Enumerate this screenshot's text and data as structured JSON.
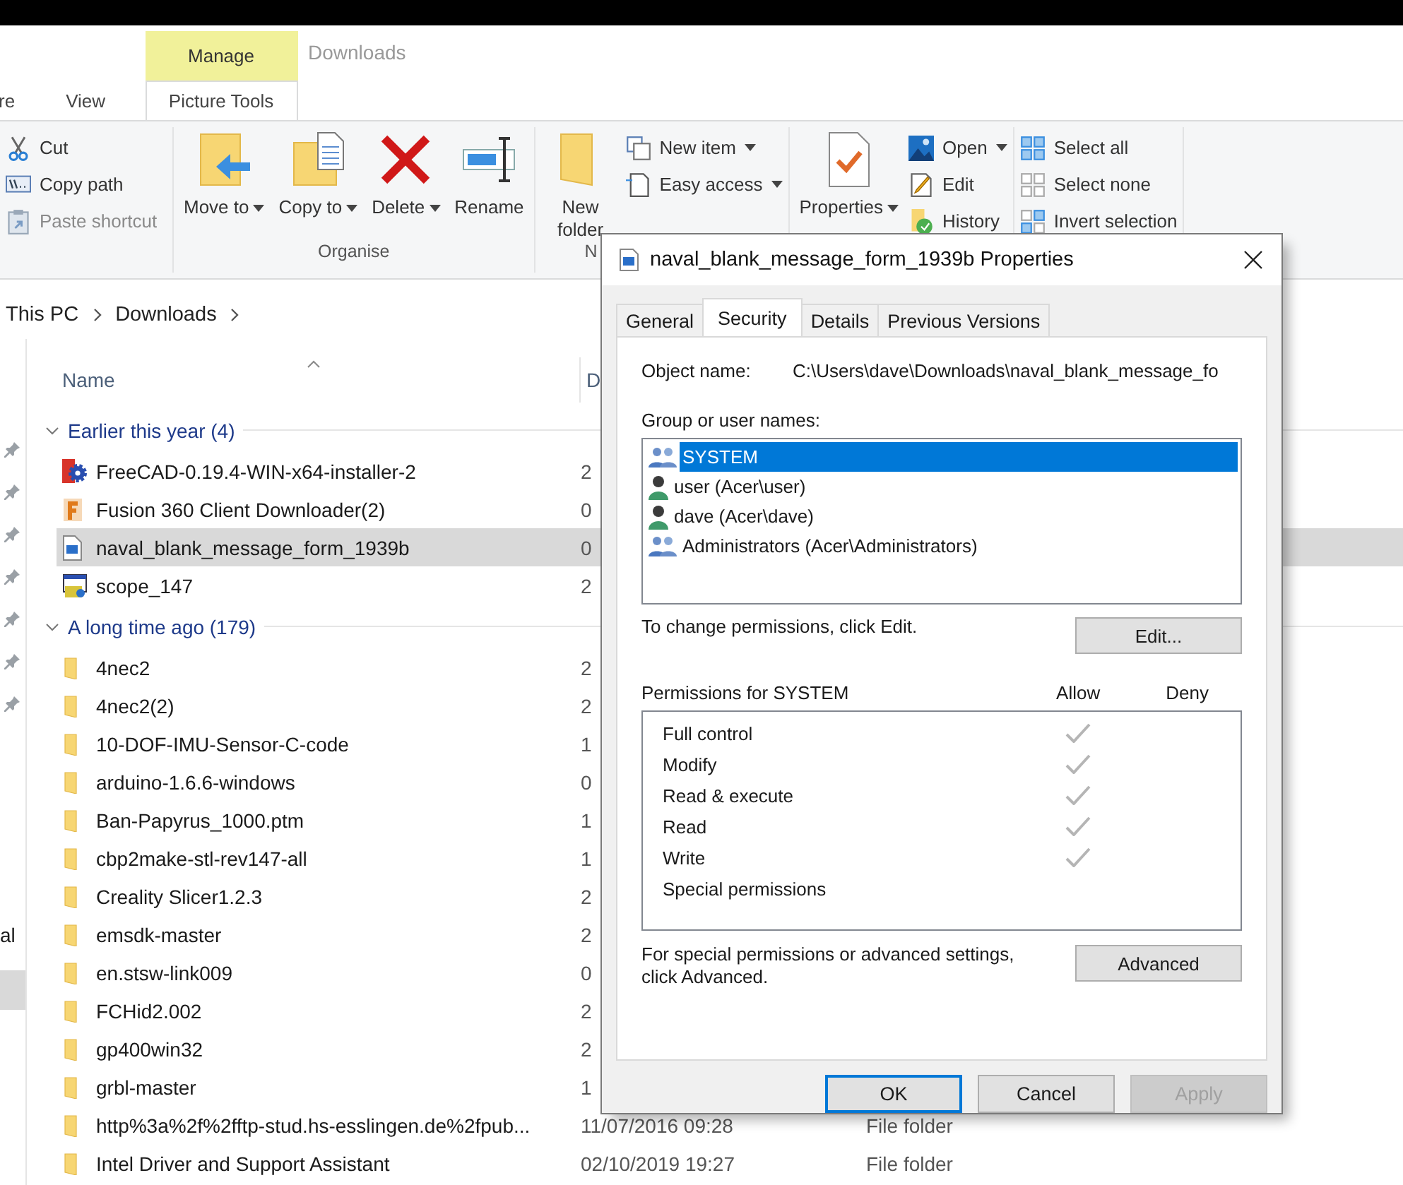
{
  "window": {
    "title": "Downloads"
  },
  "ribbon_tabs": [
    {
      "label": "re",
      "selected": false
    },
    {
      "label": "View",
      "selected": false
    },
    {
      "label": "Picture Tools",
      "selected": true,
      "context": "Manage"
    }
  ],
  "ribbon_groups": [
    {
      "items": [
        {
          "kind": "small",
          "label": "Cut",
          "dropdown": false,
          "disabled": false
        },
        {
          "kind": "small",
          "label": "Copy path",
          "dropdown": false,
          "disabled": false
        },
        {
          "kind": "small",
          "label": "Paste shortcut",
          "dropdown": false,
          "disabled": true
        }
      ]
    },
    {
      "label": "Organise",
      "items": [
        {
          "kind": "large",
          "label": "Move to",
          "dropdown": true,
          "disabled": false
        },
        {
          "kind": "large",
          "label": "Copy to",
          "dropdown": true,
          "disabled": false
        },
        {
          "kind": "large",
          "label": "Delete",
          "dropdown": true,
          "disabled": false
        },
        {
          "kind": "large",
          "label": "Rename",
          "dropdown": false,
          "disabled": false
        }
      ]
    },
    {
      "label": "N",
      "items": [
        {
          "kind": "large",
          "label": "New folder",
          "dropdown": false,
          "disabled": false
        },
        {
          "kind": "small",
          "label": "New item",
          "dropdown": true,
          "disabled": false
        },
        {
          "kind": "small",
          "label": "Easy access",
          "dropdown": true,
          "disabled": false
        }
      ]
    },
    {
      "items": [
        {
          "kind": "large",
          "label": "Properties",
          "dropdown": true,
          "disabled": false
        },
        {
          "kind": "small",
          "label": "Open",
          "dropdown": true,
          "disabled": false
        },
        {
          "kind": "small",
          "label": "Edit",
          "dropdown": false,
          "disabled": false
        },
        {
          "kind": "small",
          "label": "History",
          "dropdown": false,
          "disabled": false
        }
      ]
    },
    {
      "items": [
        {
          "kind": "small",
          "label": "Select all",
          "dropdown": false,
          "disabled": false
        },
        {
          "kind": "small",
          "label": "Select none",
          "dropdown": false,
          "disabled": false
        },
        {
          "kind": "small",
          "label": "Invert selection",
          "dropdown": false,
          "disabled": false
        }
      ]
    }
  ],
  "breadcrumbs": [
    "This PC",
    "Downloads"
  ],
  "quick_access": [
    {
      "pinned": true
    },
    {
      "pinned": true
    },
    {
      "pinned": true
    },
    {
      "pinned": true
    },
    {
      "pinned": true
    },
    {
      "pinned": true
    },
    {
      "pinned": true
    }
  ],
  "nav_items": [
    {
      "label": "al",
      "selected": false
    },
    {
      "selected": true
    }
  ],
  "columns": [
    {
      "label": "Name",
      "sorted": true
    },
    {
      "label": "D",
      "sorted": false
    }
  ],
  "groups": [
    {
      "label": "Earlier this year (4)",
      "expanded": true,
      "rows": [
        {
          "kind": "installer",
          "name": "FreeCAD-0.19.4-WIN-x64-installer-2",
          "date": "2",
          "selected": false
        },
        {
          "kind": "app",
          "name": "Fusion 360 Client Downloader(2)",
          "date": "0",
          "selected": false
        },
        {
          "kind": "image",
          "name": "naval_blank_message_form_1939b",
          "date": "0",
          "selected": true
        },
        {
          "kind": "program",
          "name": "scope_147",
          "date": "2",
          "selected": false
        }
      ]
    },
    {
      "label": "A long time ago (179)",
      "expanded": true,
      "rows": [
        {
          "kind": "folder",
          "name": "4nec2",
          "date": "2",
          "selected": false
        },
        {
          "kind": "folder",
          "name": "4nec2(2)",
          "date": "2",
          "selected": false
        },
        {
          "kind": "folder",
          "name": "10-DOF-IMU-Sensor-C-code",
          "date": "1",
          "selected": false
        },
        {
          "kind": "folder",
          "name": "arduino-1.6.6-windows",
          "date": "0",
          "selected": false
        },
        {
          "kind": "folder",
          "name": "Ban-Papyrus_1000.ptm",
          "date": "1",
          "selected": false
        },
        {
          "kind": "folder",
          "name": "cbp2make-stl-rev147-all",
          "date": "1",
          "selected": false
        },
        {
          "kind": "folder",
          "name": "Creality Slicer1.2.3",
          "date": "2",
          "selected": false
        },
        {
          "kind": "folder",
          "name": "emsdk-master",
          "date": "2",
          "selected": false
        },
        {
          "kind": "folder",
          "name": "en.stsw-link009",
          "date": "0",
          "selected": false
        },
        {
          "kind": "folder",
          "name": "FCHid2.002",
          "date": "2",
          "selected": false
        },
        {
          "kind": "folder",
          "name": "gp400win32",
          "date": "2",
          "selected": false
        },
        {
          "kind": "folder",
          "name": "grbl-master",
          "date": "1",
          "selected": false
        },
        {
          "kind": "folder",
          "name": "http%3a%2f%2fftp-stud.hs-esslingen.de%2fpub...",
          "date": "11/07/2016 09:28",
          "type": "File folder",
          "selected": false
        },
        {
          "kind": "folder",
          "name": "Intel Driver and Support Assistant",
          "date": "02/10/2019 19:27",
          "type": "File folder",
          "selected": false
        }
      ]
    }
  ],
  "dialog": {
    "title": "naval_blank_message_form_1939b Properties",
    "tabs": [
      {
        "label": "General",
        "selected": false
      },
      {
        "label": "Security",
        "selected": true
      },
      {
        "label": "Details",
        "selected": false
      },
      {
        "label": "Previous Versions",
        "selected": false
      }
    ],
    "object_name_label": "Object name:",
    "object_name": "C:\\Users\\dave\\Downloads\\naval_blank_message_fo",
    "users_label": "Group or user names:",
    "users": [
      {
        "kind": "group",
        "name": "SYSTEM",
        "selected": true
      },
      {
        "kind": "user",
        "name": "user (Acer\\user)",
        "selected": false
      },
      {
        "kind": "user",
        "name": "dave (Acer\\dave)",
        "selected": false
      },
      {
        "kind": "group",
        "name": "Administrators (Acer\\Administrators)",
        "selected": false
      }
    ],
    "change_note": "To change permissions, click Edit.",
    "edit_button": "Edit...",
    "permissions_label": "Permissions for SYSTEM",
    "allow_label": "Allow",
    "deny_label": "Deny",
    "permissions": [
      {
        "name": "Full control",
        "allow": true,
        "deny": false
      },
      {
        "name": "Modify",
        "allow": true,
        "deny": false
      },
      {
        "name": "Read & execute",
        "allow": true,
        "deny": false
      },
      {
        "name": "Read",
        "allow": true,
        "deny": false
      },
      {
        "name": "Write",
        "allow": true,
        "deny": false
      },
      {
        "name": "Special permissions",
        "allow": false,
        "deny": false
      }
    ],
    "advanced_note": "For special permissions or advanced settings, click Advanced.",
    "advanced_button": "Advanced",
    "buttons": [
      {
        "label": "OK",
        "default": true,
        "disabled": false
      },
      {
        "label": "Cancel",
        "default": false,
        "disabled": false
      },
      {
        "label": "Apply",
        "default": false,
        "disabled": true
      }
    ]
  }
}
